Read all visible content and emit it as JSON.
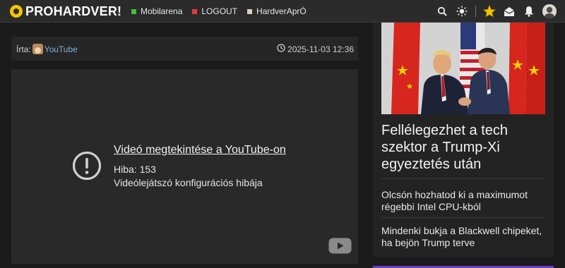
{
  "header": {
    "logo_text": "PROHARDVER!",
    "nav": [
      {
        "label": "Mobilarena",
        "color": "#3fbf3f"
      },
      {
        "label": "LOGOUT",
        "color": "#e03a3a"
      },
      {
        "label": "HardverAprÓ",
        "color": "#d8d0b8"
      }
    ],
    "icons": [
      "search-icon",
      "theme-sun-icon",
      "star-icon",
      "mail-icon",
      "bell-icon",
      "user-avatar"
    ]
  },
  "article": {
    "author_label": "Írta:",
    "author_name": "YouTube",
    "date": "2025-11-03 12:36"
  },
  "video": {
    "error_title": "Videó megtekintése a YouTube-on",
    "error_code": "Hiba: 153",
    "error_desc": "Videólejátszó konfigurációs hibája"
  },
  "sidebar": {
    "headline": "Fellélegezhet a tech szektor a Trump-Xi egyeztetés után",
    "items": [
      "Olcsón hozhatod ki a maximumot régebbi Intel CPU-kból",
      "Mindenki bukja a Blackwell chipeket, ha bejön Trump terve"
    ]
  },
  "colors": {
    "accent_star": "#f5c400",
    "link": "#7fb0d8",
    "brand_purple": "#6a3cc0"
  }
}
